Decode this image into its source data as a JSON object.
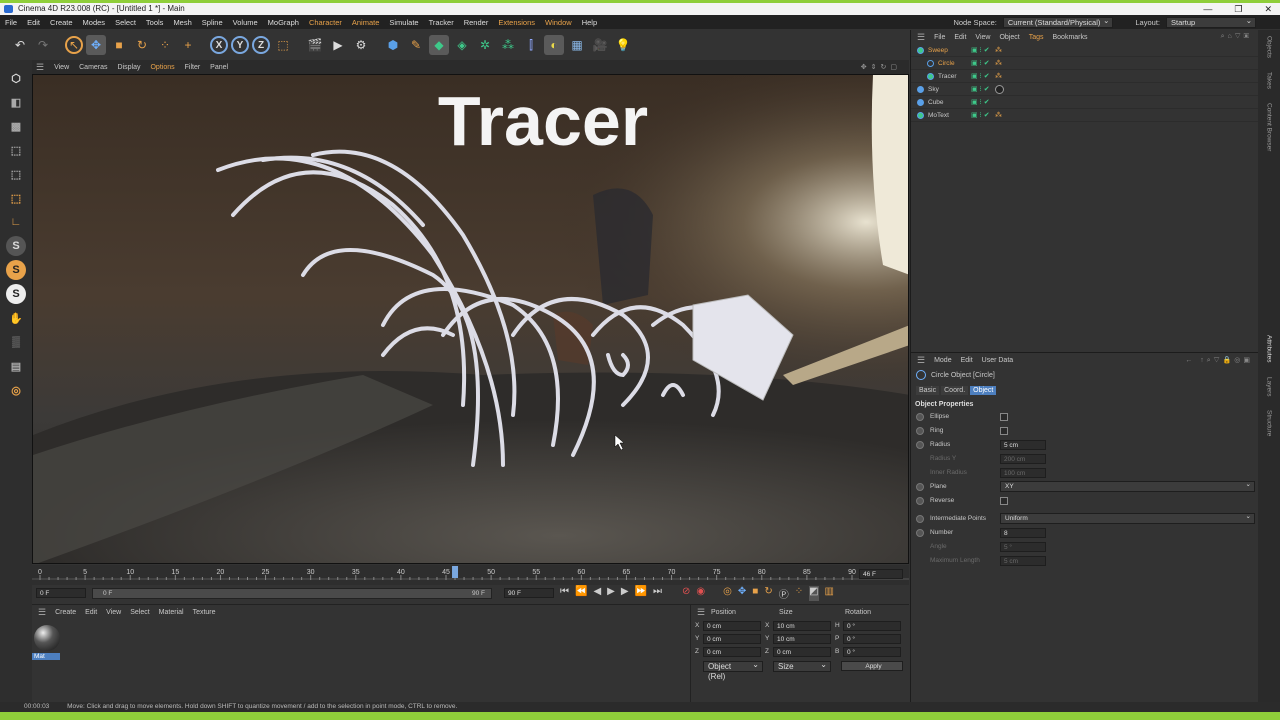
{
  "window": {
    "title": "Cinema 4D R23.008 (RC) - [Untitled 1 *] - Main",
    "minimize": "—",
    "restore": "❐",
    "close": "✕"
  },
  "menu": [
    "File",
    "Edit",
    "Create",
    "Modes",
    "Select",
    "Tools",
    "Mesh",
    "Spline",
    "Volume",
    "MoGraph",
    "Character",
    "Animate",
    "Simulate",
    "Tracker",
    "Render",
    "Extensions",
    "Window",
    "Help"
  ],
  "node_space": {
    "label": "Node Space:",
    "value": "Current (Standard/Physical)",
    "layout_label": "Layout:",
    "layout_value": "Startup"
  },
  "viewport": {
    "menu": [
      "View",
      "Cameras",
      "Display",
      "Options",
      "Filter",
      "Panel"
    ],
    "overlay_text": "Tracer"
  },
  "timeline": {
    "ticks": [
      "0",
      "5",
      "10",
      "15",
      "20",
      "25",
      "30",
      "35",
      "40",
      "45",
      "50",
      "55",
      "60",
      "65",
      "70",
      "75",
      "80",
      "85",
      "90"
    ],
    "current_frame": "46",
    "frame_display": "46 F",
    "start": "0 F",
    "range_start": "0 F",
    "range_end": "90 F",
    "end": "90 F"
  },
  "material_manager": {
    "menu": [
      "Create",
      "Edit",
      "View",
      "Select",
      "Material",
      "Texture"
    ],
    "material_name": "Mat"
  },
  "coordinates": {
    "headers": [
      "Position",
      "Size",
      "Rotation"
    ],
    "rows": [
      {
        "axis": "X",
        "pos": "0 cm",
        "saxis": "X",
        "size": "10 cm",
        "raxis": "H",
        "rot": "0 °"
      },
      {
        "axis": "Y",
        "pos": "0 cm",
        "saxis": "Y",
        "size": "10 cm",
        "raxis": "P",
        "rot": "0 °"
      },
      {
        "axis": "Z",
        "pos": "0 cm",
        "saxis": "Z",
        "size": "0 cm",
        "raxis": "B",
        "rot": "0 °"
      }
    ],
    "mode": "Object (Rel)",
    "size_mode": "Size",
    "apply": "Apply"
  },
  "object_manager": {
    "menu": [
      "File",
      "Edit",
      "View",
      "Object",
      "Tags",
      "Bookmarks"
    ],
    "objects": [
      {
        "name": "Sweep",
        "indent": 0,
        "color": "#e8a24a"
      },
      {
        "name": "Circle",
        "indent": 1,
        "color": "#e8a24a"
      },
      {
        "name": "Tracer",
        "indent": 1,
        "color": "#c8c8c8"
      },
      {
        "name": "Sky",
        "indent": 0,
        "color": "#c8c8c8"
      },
      {
        "name": "Cube",
        "indent": 0,
        "color": "#c8c8c8"
      },
      {
        "name": "MoText",
        "indent": 0,
        "color": "#c8c8c8"
      }
    ]
  },
  "attributes": {
    "menu": [
      "Mode",
      "Edit",
      "User Data"
    ],
    "object_title": "Circle Object [Circle]",
    "tabs": [
      "Basic",
      "Coord.",
      "Object"
    ],
    "active_tab": "Object",
    "section": "Object Properties",
    "props": [
      {
        "label": "Ellipse",
        "type": "check",
        "dim": false
      },
      {
        "label": "Ring",
        "type": "check",
        "dim": false
      },
      {
        "label": "Radius",
        "type": "field",
        "value": "5 cm",
        "dim": false
      },
      {
        "label": "Radius Y",
        "type": "field",
        "value": "200 cm",
        "dim": true
      },
      {
        "label": "Inner Radius",
        "type": "field",
        "value": "100 cm",
        "dim": true
      },
      {
        "label": "Plane",
        "type": "select",
        "value": "XY",
        "dim": false
      },
      {
        "label": "Reverse",
        "type": "check",
        "dim": false
      },
      {
        "label": "Intermediate Points",
        "type": "select",
        "value": "Uniform",
        "dim": false
      },
      {
        "label": "Number",
        "type": "field",
        "value": "8",
        "dim": false
      },
      {
        "label": "Angle",
        "type": "field",
        "value": "5 °",
        "dim": true
      },
      {
        "label": "Maximum Length",
        "type": "field",
        "value": "5 cm",
        "dim": true
      }
    ]
  },
  "side_tabs": [
    "Objects",
    "Takes",
    "Content Browser",
    "Attributes",
    "Layers",
    "Structure"
  ],
  "status": {
    "time": "00:00:03",
    "message": "Move: Click and drag to move elements. Hold down SHIFT to quantize movement / add to the selection in point mode, CTRL to remove."
  },
  "colors": {
    "accent_green": "#8fce3a",
    "selection_orange": "#e8a24a",
    "active_tab": "#4d7fbf"
  }
}
